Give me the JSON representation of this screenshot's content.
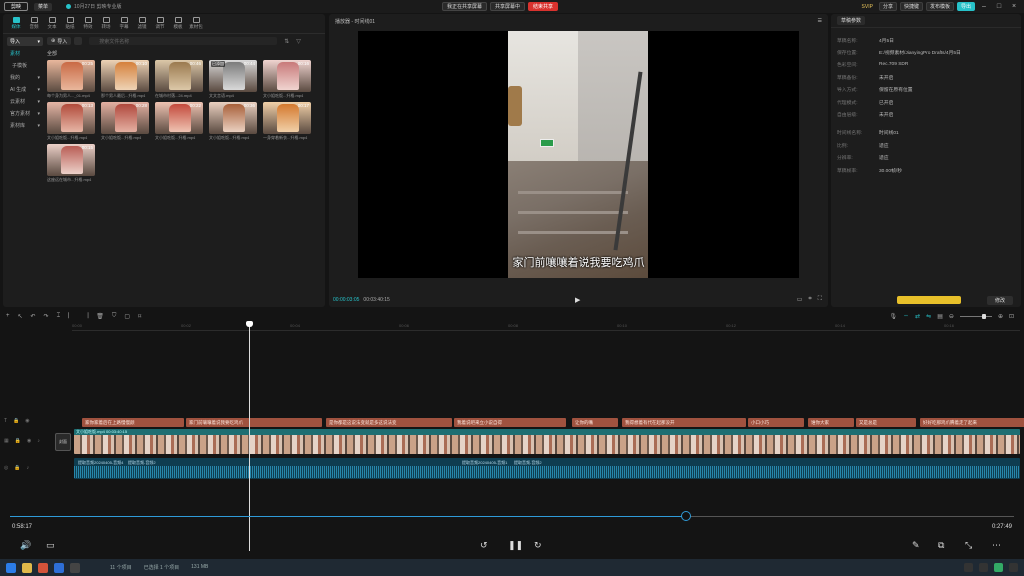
{
  "titlebar": {
    "logo": "剪映",
    "menu": "菜单",
    "project": "10月27日 剪映专业版",
    "share_status": "我正在共享屏幕",
    "share_chip": "共享屏幕中",
    "stop_share": "结束共享",
    "vip": "SVIP",
    "btn_share": "分享",
    "btn_shortcut": "快捷键",
    "btn_publish": "发布模板",
    "btn_export": "导出"
  },
  "media": {
    "tabs": [
      "媒体",
      "音频",
      "文本",
      "贴纸",
      "特效",
      "转场",
      "字幕",
      "滤镜",
      "调节",
      "模板",
      "素材包"
    ],
    "side": [
      {
        "label": "导入",
        "active": true,
        "arrow": "▾"
      },
      {
        "label": "素材",
        "sub": true
      },
      {
        "label": "子模板",
        "plain": true
      },
      {
        "label": "我的",
        "arrow": "▾"
      },
      {
        "label": "AI 生成",
        "arrow": "▾"
      },
      {
        "label": "云素材",
        "arrow": "▾"
      },
      {
        "label": "官方素材",
        "arrow": "▾"
      },
      {
        "label": "素材库",
        "arrow": "▾"
      }
    ],
    "import_label": "导入",
    "search_placeholder": "搜索文件名称",
    "all_label": "全部",
    "clips": [
      {
        "dur": "00:25",
        "name": "每个身为男人..._01.mp4",
        "c1": "#c96a45",
        "c2": "#e9b79c"
      },
      {
        "dur": "00:10",
        "name": "那个男人最后...升格.mp4",
        "c1": "#d5813c",
        "c2": "#eed3b5"
      },
      {
        "dur": "00:46",
        "name": "在城市村落...24.mp4",
        "c1": "#9b7a4f",
        "c2": "#dcc8a8"
      },
      {
        "dur": "00:44",
        "name": "文文言语.mp4",
        "c1": "#7c7c7c",
        "c2": "#d9d9d9",
        "added": "已添加"
      },
      {
        "dur": "00:16",
        "name": "文小姐吃饭...升格.mp4",
        "c1": "#c87a7a",
        "c2": "#f0d4d0"
      },
      {
        "dur": "00:13",
        "name": "文小姐吃饭...升格.mp4",
        "c1": "#b14a3a",
        "c2": "#e6b6a6"
      },
      {
        "dur": "00:28",
        "name": "文小姐吃饭...升格.mp4",
        "c1": "#b0483d",
        "c2": "#e4b0a2"
      },
      {
        "dur": "00:22",
        "name": "文小姐吃饭...升格.mp4",
        "c1": "#c34a3c",
        "c2": "#efc3b2"
      },
      {
        "dur": "00:36",
        "name": "文小姐吃饭...升格.mp4",
        "c1": "#a8603a",
        "c2": "#ead0c0"
      },
      {
        "dur": "00:17",
        "name": "一身穿着新衣...升格.mp4",
        "c1": "#d4792e",
        "c2": "#f1d0a8"
      },
      {
        "dur": "00:15",
        "name": "这座远在城市...升格.mp4",
        "c1": "#b95d55",
        "c2": "#ecd0c8"
      }
    ]
  },
  "player": {
    "title": "播放器 - 时间线01",
    "menu": "☰",
    "subtitle": "家门前嚷嚷着说我要吃鸡爪",
    "tc_current": "00:00:03:05",
    "tc_total": "00:03:40:15"
  },
  "props": {
    "tab": "草稿参数",
    "rows": [
      {
        "k": "草稿名称:",
        "v": "4月5日"
      },
      {
        "k": "保存位置:",
        "v": "E:/视频素材/JianyingPro Drafts/4月5日"
      },
      {
        "k": "色彩空间:",
        "v": "Rec.709 SDR"
      },
      {
        "k": "草稿备份:",
        "v": "未开启"
      },
      {
        "k": "导入方式:",
        "v": "保留在原有位置"
      },
      {
        "k": "代理模式:",
        "v": "已开启"
      },
      {
        "k": "自由层级:",
        "v": "未开启"
      },
      {
        "k": "时间线名称:",
        "v": "时间线01",
        "gap": true
      },
      {
        "k": "比例:",
        "v": "适应"
      },
      {
        "k": "分辨率:",
        "v": "适应"
      },
      {
        "k": "草稿帧率:",
        "v": "30.00帧/秒"
      }
    ],
    "modify": "修改"
  },
  "timeline": {
    "ticks": [
      "00:00",
      "00:02",
      "00:04",
      "00:06",
      "00:08",
      "00:10",
      "00:12",
      "00:14",
      "00:16"
    ],
    "text_clips": [
      {
        "t": "家你家着后在上路慢慢颜",
        "w": 102
      },
      {
        "t": "家门前嚷嚷着说我要吃鸡爪",
        "w": 136
      },
      {
        "t": "是你都是这说法变就是多这说法变",
        "w": 126
      },
      {
        "t": "我着说吧来立小说自得",
        "w": 112
      },
      {
        "t": "让你的嘴",
        "w": 46
      },
      {
        "t": "我得想着有代在起那没开",
        "w": 124
      },
      {
        "t": "小口小巧",
        "w": 56
      },
      {
        "t": "谁你大家",
        "w": 46
      },
      {
        "t": "又是总是",
        "w": 60
      },
      {
        "t": "好好吃那鸡爪腾着走了起来",
        "w": 112
      }
    ],
    "video_label": "文小姐吃饭.mp4   00:03:40:15",
    "cover": "封面",
    "audio_labels": [
      "提取音频20240405-音频4",
      "提取音频-音频2",
      "提取音频20240405-音频1",
      "提取音频-音频2"
    ]
  },
  "outer_player": {
    "time_left": "0:58:17",
    "time_right": "0:27:49"
  },
  "taskbar": {
    "status": [
      "11 个项目",
      "已选择 1 个项目",
      "131 MB"
    ]
  }
}
